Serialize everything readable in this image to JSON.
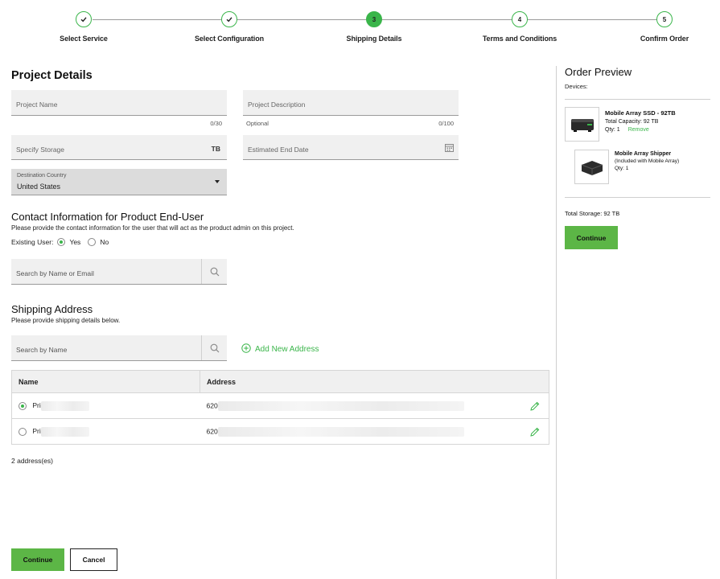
{
  "stepper": {
    "steps": [
      {
        "number": "",
        "label": "Select Service",
        "state": "done"
      },
      {
        "number": "",
        "label": "Select Configuration",
        "state": "done"
      },
      {
        "number": "3",
        "label": "Shipping Details",
        "state": "active"
      },
      {
        "number": "4",
        "label": "Terms and Conditions",
        "state": "pending"
      },
      {
        "number": "5",
        "label": "Confirm Order",
        "state": "pending"
      }
    ]
  },
  "project": {
    "title": "Project Details",
    "name_placeholder": "Project Name",
    "name_counter": "0/30",
    "description_placeholder": "Project Description",
    "description_hint": "Optional",
    "description_counter": "0/100",
    "storage_placeholder": "Specify Storage",
    "storage_unit": "TB",
    "end_date_placeholder": "Estimated End Date",
    "country_label": "Destination Country",
    "country_value": "United States"
  },
  "contact": {
    "title": "Contact Information for Product End-User",
    "description": "Please provide the contact information for the user that will act as the product admin on this project.",
    "existing_user_label": "Existing User:",
    "yes_label": "Yes",
    "no_label": "No",
    "selected": "Yes",
    "search_placeholder": "Search by Name or Email"
  },
  "shipping": {
    "title": "Shipping Address",
    "description": "Please provide shipping details below.",
    "search_placeholder": "Search by Name",
    "add_new_label": "Add New Address",
    "columns": {
      "name": "Name",
      "address": "Address"
    },
    "rows": [
      {
        "name": "Pri",
        "address": "620",
        "selected": true
      },
      {
        "name": "Pri",
        "address": "620",
        "selected": false
      }
    ],
    "count_label": "2 address(es)"
  },
  "actions": {
    "continue_label": "Continue",
    "cancel_label": "Cancel"
  },
  "order_preview": {
    "title": "Order Preview",
    "devices_label": "Devices:",
    "device": {
      "name": "Mobile Array SSD - 92TB",
      "capacity": "Total Capacity: 92 TB",
      "qty": "Qty: 1",
      "remove_label": "Remove"
    },
    "accessory": {
      "name_line1": "Mobile Array Shipper",
      "name_line2": "(Included with Mobile Array)",
      "qty": "Qty: 1"
    },
    "total_storage": "Total Storage: 92 TB",
    "continue_label": "Continue"
  },
  "colors": {
    "accent": "#3ab54a",
    "button_green": "#5cb646",
    "field_bg": "#f0f0f0",
    "select_bg": "#dcdcdc"
  },
  "icons": {
    "done_step": "check-icon",
    "search": "search-icon",
    "calendar": "calendar-icon",
    "add": "plus-circle-icon",
    "edit": "pencil-icon"
  }
}
